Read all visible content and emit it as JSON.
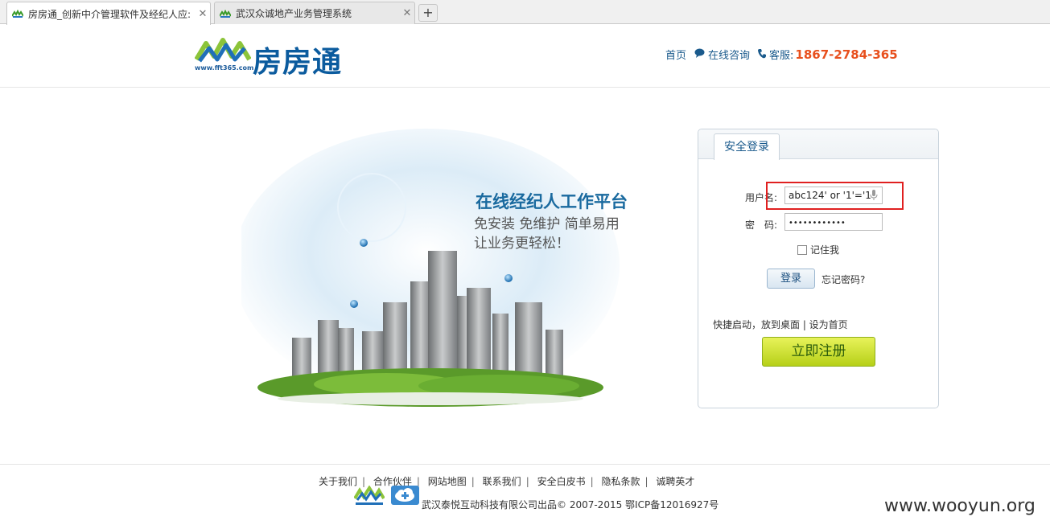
{
  "browser": {
    "tabs": [
      {
        "title": "房房通_创新中介管理软件及经纪人应:",
        "active": true
      },
      {
        "title": "武汉众诚地产业务管理系统",
        "active": false
      }
    ],
    "new_tab_label": "+"
  },
  "header": {
    "logo_text": "房房通",
    "logo_url": "www.fft365.com",
    "nav": {
      "home": "首页",
      "consult": "在线咨询",
      "service_label": "客服:",
      "phone": "1867-2784-365"
    }
  },
  "hero": {
    "title": "在线经纪人工作平台",
    "subtitle_line1": "免安装 免维护 简单易用",
    "subtitle_line2": "让业务更轻松！"
  },
  "login": {
    "tab": "安全登录",
    "username_label": "用户名:",
    "username_value": "abc124' or '1'='1",
    "password_label": "密　码:",
    "password_value": "••••••••••••",
    "remember_label": "记住我",
    "remember_checked": false,
    "login_button": "登录",
    "forgot": "忘记密码?",
    "quick_links": "快捷启动，放到桌面 | 设为首页",
    "register_button": "立即注册"
  },
  "footer": {
    "links": [
      "关于我们",
      "合作伙伴",
      "网站地图",
      "联系我们",
      "安全白皮书",
      "隐私条款",
      "诚聘英才"
    ],
    "copyright": "武汉泰悦互动科技有限公司出品© 2007-2015 鄂ICP备12016927号",
    "watermark": "www.wooyun.org"
  },
  "colors": {
    "brand_blue": "#0b5b9e",
    "phone_orange": "#e8501e",
    "highlight_red": "#e02020",
    "register_green": "#b6d018"
  }
}
